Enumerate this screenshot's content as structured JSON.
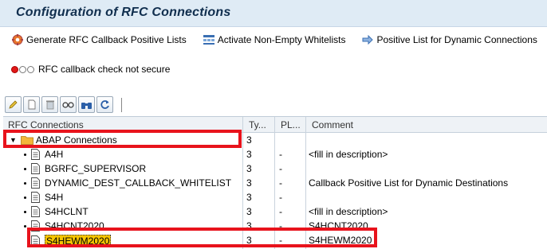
{
  "title": "Configuration of RFC Connections",
  "app_toolbar": {
    "generate_label": "Generate RFC Callback Positive Lists",
    "activate_label": "Activate Non-Empty Whitelists",
    "positive_list_label": "Positive List for Dynamic Connections"
  },
  "status": {
    "text": "RFC callback check not secure",
    "light_color": "#e01818"
  },
  "table": {
    "headers": {
      "name": "RFC Connections",
      "type": "Ty...",
      "pl": "PL...",
      "comment": "Comment"
    },
    "folder": {
      "name": "ABAP Connections",
      "type": "3"
    },
    "rows": [
      {
        "name": "A4H",
        "type": "3",
        "pl": "-",
        "comment": "<fill in description>"
      },
      {
        "name": "BGRFC_SUPERVISOR",
        "type": "3",
        "pl": "-",
        "comment": ""
      },
      {
        "name": "DYNAMIC_DEST_CALLBACK_WHITELIST",
        "type": "3",
        "pl": "-",
        "comment": "Callback Positive List for Dynamic Destinations"
      },
      {
        "name": "S4H",
        "type": "3",
        "pl": "-",
        "comment": ""
      },
      {
        "name": "S4HCLNT",
        "type": "3",
        "pl": "-",
        "comment": "<fill in description>"
      },
      {
        "name": "S4HCNT2020",
        "type": "3",
        "pl": "-",
        "comment": "S4HCNT2020"
      },
      {
        "name": "S4HEWM2020",
        "type": "3",
        "pl": "-",
        "comment": "S4HEWM2020"
      }
    ]
  },
  "colors": {
    "highlight": "#e8131c",
    "selection": "#f6c400",
    "title": "#102e4e"
  }
}
